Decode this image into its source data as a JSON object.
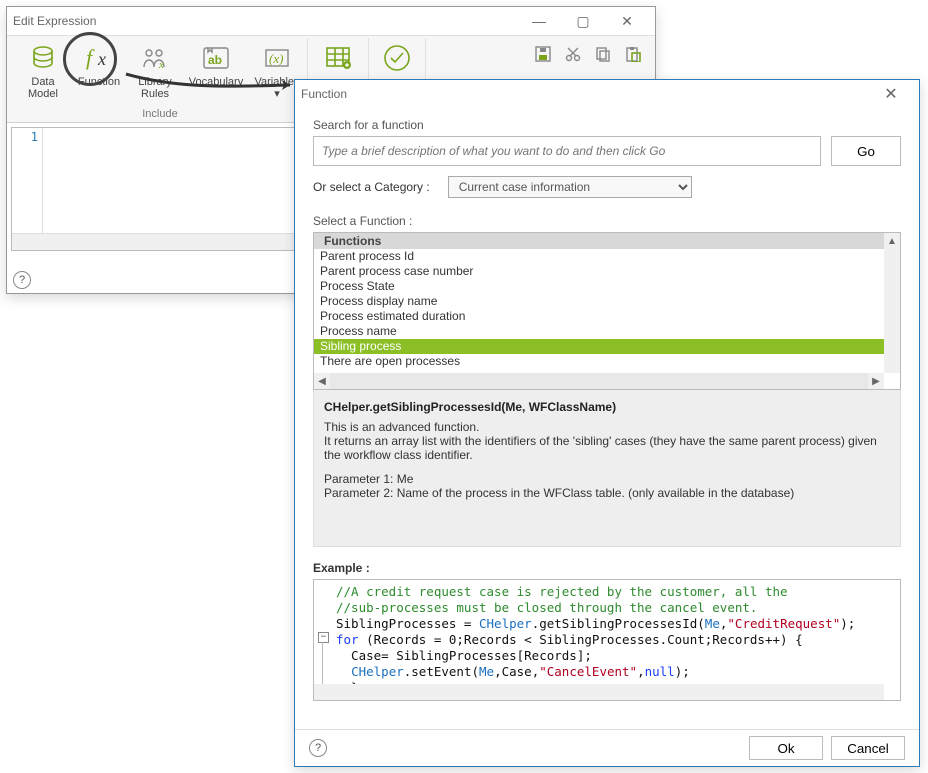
{
  "editExpr": {
    "title": "Edit Expression",
    "ribbon": {
      "data_model": "Data\nModel",
      "function": "Function",
      "library_rules": "Library\nRules",
      "vocabulary": "Vocabulary",
      "variables": "Variables",
      "group_label": "Include"
    },
    "gutter_line": "1"
  },
  "functionDialog": {
    "title": "Function",
    "search_label": "Search for a function",
    "search_placeholder": "Type a brief description of what you want to do and then click Go",
    "go": "Go",
    "or_select": "Or select a Category :",
    "category": "Current case information",
    "select_fn": "Select a Function :",
    "list_header": "Functions",
    "functions": [
      "Parent process Id",
      "Parent process case number",
      "Process State",
      "Process display name",
      "Process estimated duration",
      "Process name",
      "Sibling process",
      "There are open processes"
    ],
    "selected_index": 6,
    "sig": "CHelper.getSiblingProcessesId(Me, WFClassName)",
    "desc_line1": "This is an advanced function.",
    "desc_line2": "It returns an array list with the identifiers of the 'sibling' cases (they have the same parent process) given the workflow class identifier.",
    "param1": "Parameter 1: Me",
    "param2": "Parameter 2: Name of the process in the WFClass table. (only available in the database)",
    "example_label": "Example :",
    "ok": "Ok",
    "cancel": "Cancel"
  },
  "code": {
    "c1": "//A credit request case is rejected by the customer, all the",
    "c2": "//sub-processes must be closed through the cancel event.",
    "assign_l": "SiblingProcesses = ",
    "assign_r": ".getSiblingProcessesId",
    "me": "Me",
    "str1": "\"CreditRequest\"",
    "for_kw": "for",
    "for_body": " (Records = 0;Records < SiblingProcesses.Count;Records++) {",
    "case_line": "  Case= SiblingProcesses[Records];",
    "setev": ".setEvent",
    "str2": "\"CancelEvent\"",
    "null_kw": "null",
    "brace": "  }",
    "chelper": "CHelper"
  }
}
